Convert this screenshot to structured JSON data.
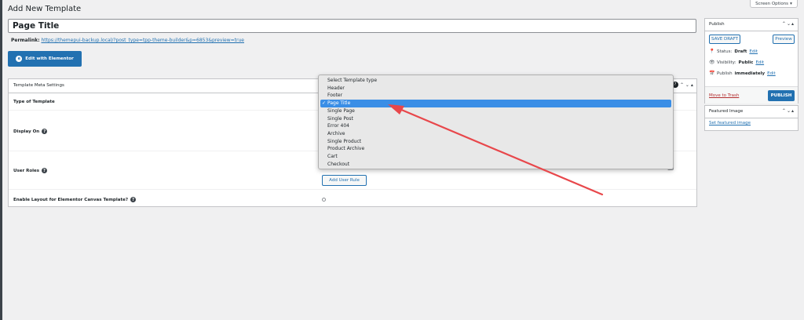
{
  "page": {
    "heading": "Add New Template",
    "screen_options": "Screen Options",
    "screen_options_caret": "▾"
  },
  "title_field": {
    "value": "Page Title"
  },
  "permalink": {
    "label": "Permalink:",
    "url": "https://themepui-backup.local/?post_type=tpp-theme-builder&p=6853&preview=true"
  },
  "elementor_button": {
    "label": "Edit with Elementor",
    "icon": "elementor-icon",
    "icon_glyph": "e"
  },
  "meta_box": {
    "title": "Template Meta Settings",
    "controls": "⌃ ⌄ ▴",
    "help_glyph": "?",
    "rows": [
      {
        "label": "Type of Template"
      },
      {
        "label": "Display On"
      },
      {
        "label": "User Roles"
      },
      {
        "label": "Enable Layout for Elementor Canvas Template?"
      }
    ],
    "add_user_rule": "Add User Rule"
  },
  "dropdown": {
    "check": "✓",
    "selected_index": 3,
    "options": [
      "Select Template type",
      "Header",
      "Footer",
      "Page Title",
      "Single Page",
      "Single Post",
      "Error 404",
      "Archive",
      "Single Product",
      "Product Archive",
      "Cart",
      "Checkout"
    ]
  },
  "publish_box": {
    "title": "Publish",
    "arrows": "⌃⌄▴",
    "save_draft": "SAVE DRAFT",
    "preview": "Preview",
    "status_label": "Status:",
    "status_value": "Draft",
    "visibility_label": "Visibility:",
    "visibility_value": "Public",
    "publish_label": "Publish",
    "publish_value": "immediately",
    "edit": "Edit",
    "move_to_trash": "Move to Trash",
    "publish_button": "PUBLISH",
    "icons": {
      "status": "📍",
      "visibility": "👁",
      "calendar": "📅"
    }
  },
  "featured_box": {
    "title": "Featured Image",
    "arrows": "⌃⌄▴",
    "link": "Set featured image"
  },
  "colors": {
    "accent": "#2271b1",
    "selection": "#3a8ee6",
    "annotation_arrow": "#e8474b",
    "trash": "#b32d2e"
  }
}
